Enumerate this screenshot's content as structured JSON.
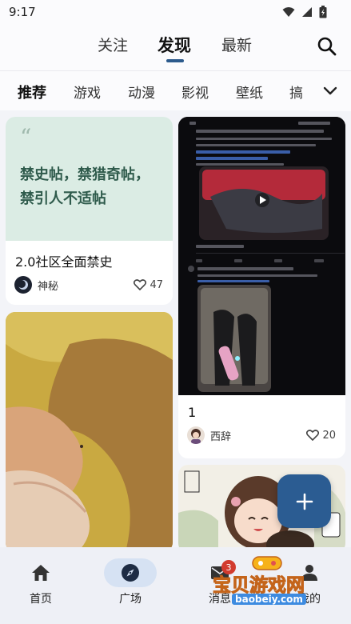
{
  "status": {
    "time": "9:17"
  },
  "top_tabs": [
    {
      "label": "关注",
      "active": false
    },
    {
      "label": "发现",
      "active": true
    },
    {
      "label": "最新",
      "active": false
    }
  ],
  "categories": [
    {
      "label": "推荐",
      "active": true
    },
    {
      "label": "游戏",
      "active": false
    },
    {
      "label": "动漫",
      "active": false
    },
    {
      "label": "影视",
      "active": false
    },
    {
      "label": "壁纸",
      "active": false
    },
    {
      "label": "搞",
      "active": false
    }
  ],
  "posts": [
    {
      "quote": "禁史帖，禁猎奇帖，禁引人不适帖",
      "title": "2.0社区全面禁史",
      "author": "神秘",
      "likes": "47"
    },
    {
      "title": "1",
      "author": "西辞",
      "likes": "20"
    },
    {
      "title": "",
      "author": "",
      "likes": ""
    },
    {
      "title": "",
      "author": "",
      "likes": ""
    }
  ],
  "bottom_nav": [
    {
      "label": "首页",
      "icon": "home-icon",
      "active": false
    },
    {
      "label": "广场",
      "icon": "compass-icon",
      "active": true
    },
    {
      "label": "消息",
      "icon": "mail-icon",
      "active": false,
      "badge": "3"
    },
    {
      "label": "我的",
      "icon": "person-icon",
      "active": false
    }
  ],
  "watermark": {
    "text": "宝贝游戏网",
    "url": "baobeiy.com"
  },
  "colors": {
    "accent": "#2b5c92",
    "quote_bg": "#dbece4",
    "quote_text": "#2f5b4c",
    "badge": "#d23b2e"
  }
}
